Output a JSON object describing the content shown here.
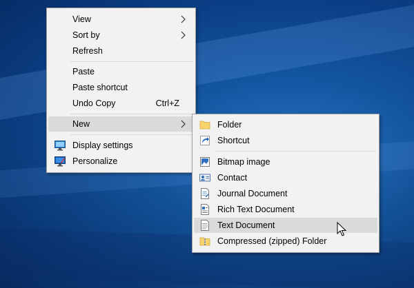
{
  "desktop": {
    "background": "#1457a6"
  },
  "context_menu": {
    "items": [
      {
        "label": "View",
        "submenu": true
      },
      {
        "label": "Sort by",
        "submenu": true
      },
      {
        "label": "Refresh"
      },
      {
        "label": "Paste"
      },
      {
        "label": "Paste shortcut"
      },
      {
        "label": "Undo Copy",
        "shortcut": "Ctrl+Z"
      },
      {
        "label": "New",
        "submenu": true,
        "highlighted": true
      },
      {
        "label": "Display settings",
        "icon": "display-settings-icon"
      },
      {
        "label": "Personalize",
        "icon": "personalize-icon"
      }
    ]
  },
  "new_submenu": {
    "items": [
      {
        "label": "Folder",
        "icon": "folder-icon"
      },
      {
        "label": "Shortcut",
        "icon": "shortcut-icon"
      },
      {
        "label": "Bitmap image",
        "icon": "bitmap-image-icon"
      },
      {
        "label": "Contact",
        "icon": "contact-icon"
      },
      {
        "label": "Journal Document",
        "icon": "journal-document-icon"
      },
      {
        "label": "Rich Text Document",
        "icon": "rich-text-document-icon"
      },
      {
        "label": "Text Document",
        "icon": "text-document-icon",
        "highlighted": true
      },
      {
        "label": "Compressed (zipped) Folder",
        "icon": "zip-folder-icon"
      }
    ]
  }
}
